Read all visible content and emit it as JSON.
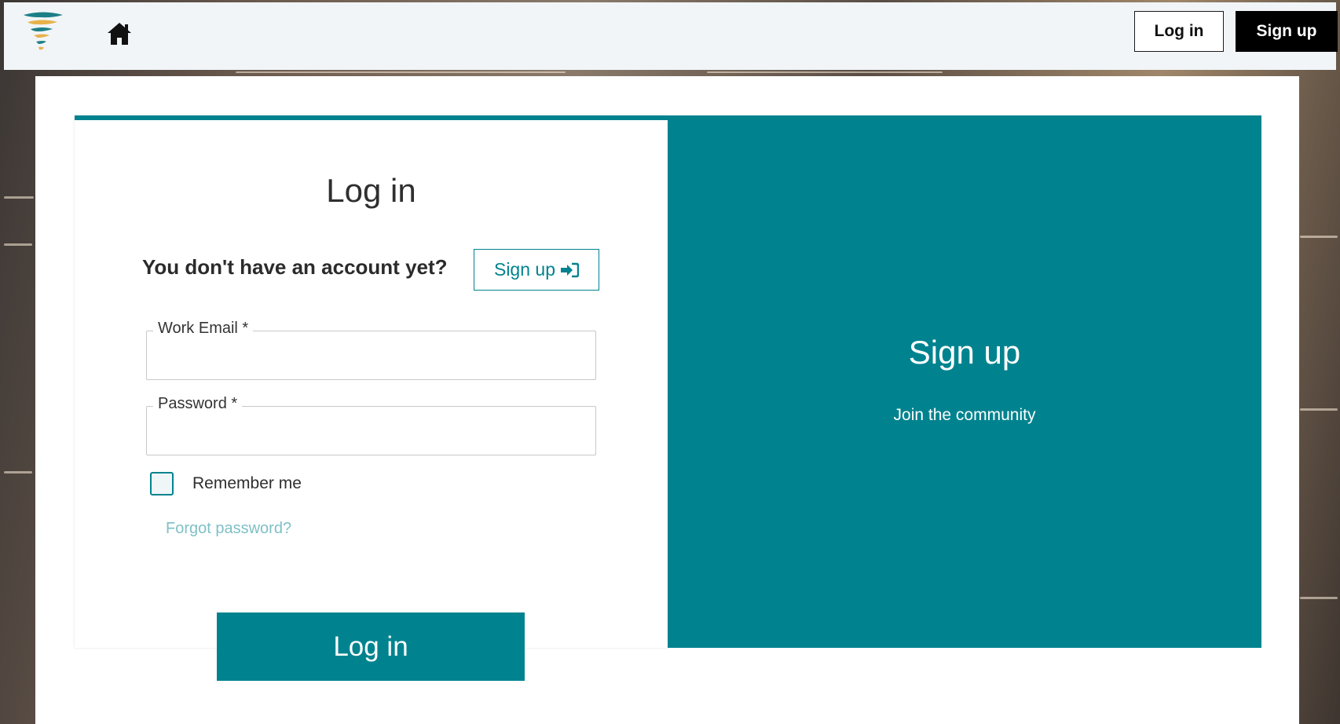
{
  "header": {
    "login_label": "Log in",
    "signup_label": "Sign up"
  },
  "login_panel": {
    "title": "Log in",
    "no_account_text": "You don't have an account yet?",
    "signup_button_label": "Sign up",
    "email_label": "Work Email *",
    "email_value": "",
    "password_label": "Password *",
    "password_value": "",
    "remember_label": "Remember me",
    "remember_checked": false,
    "forgot_label": "Forgot password?",
    "submit_label": "Log in"
  },
  "signup_panel": {
    "title": "Sign up",
    "subtitle": "Join the community"
  },
  "colors": {
    "accent": "#00838f",
    "link": "#7fc0c6",
    "header_bg": "#f1f5f8"
  },
  "icons": {
    "logo": "tornado-logo-icon",
    "home": "home-icon",
    "signup": "sign-in-arrow-icon"
  }
}
